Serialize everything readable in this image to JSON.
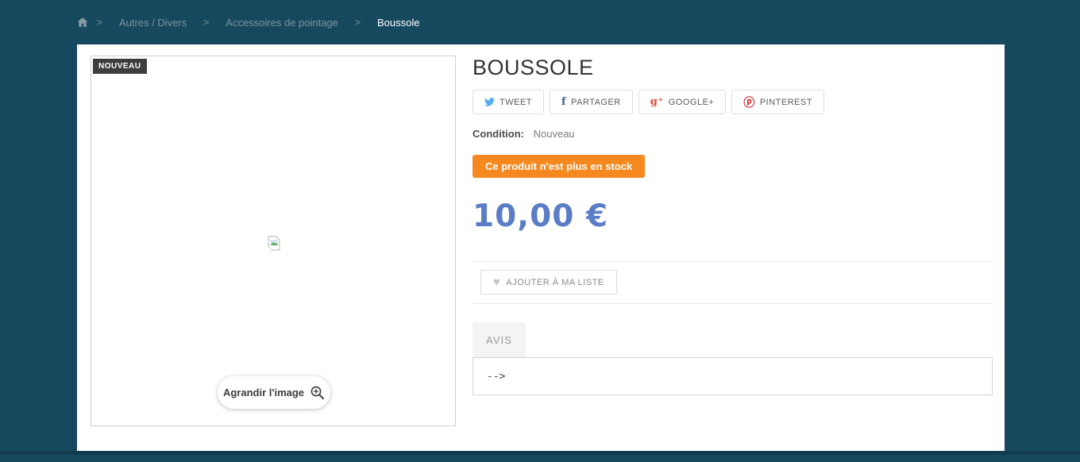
{
  "breadcrumb": {
    "home_icon": "home-icon",
    "separator": ">",
    "items": [
      {
        "label": "Autres / Divers"
      },
      {
        "label": "Accessoires de pointage"
      },
      {
        "label": "Boussole",
        "current": true
      }
    ]
  },
  "product": {
    "title": "BOUSSOLE",
    "new_badge": "NOUVEAU",
    "zoom_button_label": "Agrandir l'image",
    "condition_label": "Condition:",
    "condition_value": "Nouveau",
    "availability_text": "Ce produit n'est plus en stock",
    "price": "10,00 €",
    "wishlist_button_label": "AJOUTER À MA LISTE"
  },
  "social": {
    "buttons": [
      {
        "label": "TWEET",
        "icon": "twitter-icon",
        "color": "#55acee",
        "glyph": ""
      },
      {
        "label": "PARTAGER",
        "icon": "facebook-icon",
        "color": "#3b5998",
        "glyph": "f"
      },
      {
        "label": "GOOGLE+",
        "icon": "google-plus-icon",
        "color": "#dd4b39",
        "glyph": "g⁺"
      },
      {
        "label": "PINTEREST",
        "icon": "pinterest-icon",
        "color": "#cb2027",
        "glyph": "ⓟ"
      }
    ]
  },
  "tabs": {
    "avis_label": "AVIS"
  },
  "review_box": {
    "text": "-->"
  },
  "colors": {
    "background": "#17495e",
    "availability_orange": "#f5891f",
    "price_blue": "#5b7cc6",
    "badge_dark": "#3d3d3d"
  }
}
